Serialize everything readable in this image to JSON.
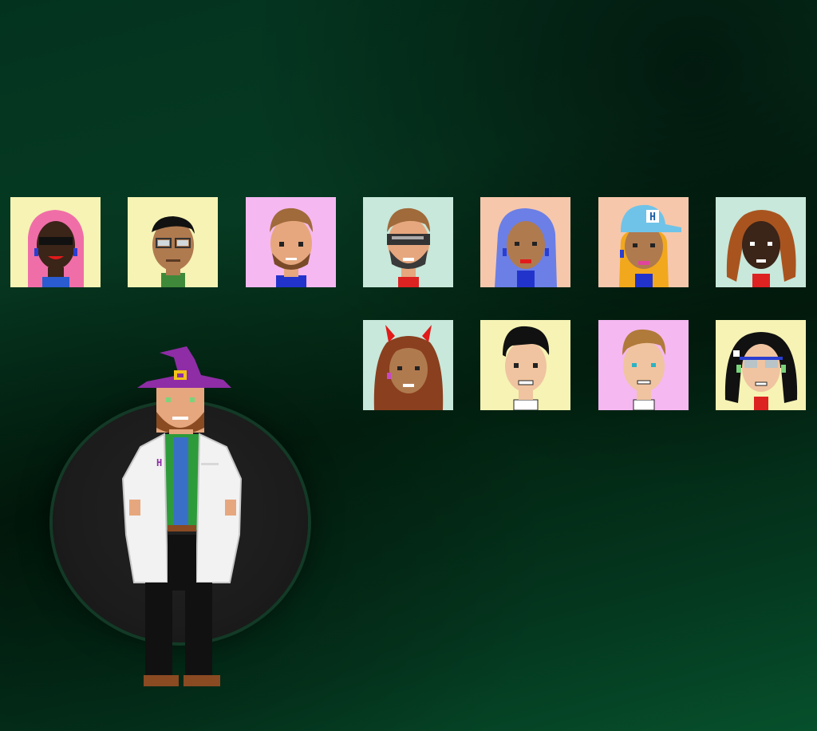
{
  "avatars_row1": [
    {
      "id": "a1",
      "bg": "#f6f3b4"
    },
    {
      "id": "a2",
      "bg": "#f6f3b4"
    },
    {
      "id": "a3",
      "bg": "#f5b8f1"
    },
    {
      "id": "a4",
      "bg": "#c7e8db"
    },
    {
      "id": "a5",
      "bg": "#f6c7ab"
    },
    {
      "id": "a6",
      "bg": "#f6c7ab"
    },
    {
      "id": "a7",
      "bg": "#c7e8db"
    }
  ],
  "avatars_row2": [
    {
      "id": "b1",
      "bg": "#c7e8db"
    },
    {
      "id": "b2",
      "bg": "#f6f3b4"
    },
    {
      "id": "b3",
      "bg": "#f5b8f1"
    },
    {
      "id": "b4",
      "bg": "#f6f3b4"
    }
  ],
  "hero": {
    "hat_color": "#8e2da6",
    "coat_color": "#f2f2f2",
    "coat_badge": "H",
    "shirt_color": "#2d9b3a"
  },
  "colors": {
    "background_top": "#03331f",
    "background_bottom": "#06502c",
    "stage": "#1c1c1c"
  }
}
